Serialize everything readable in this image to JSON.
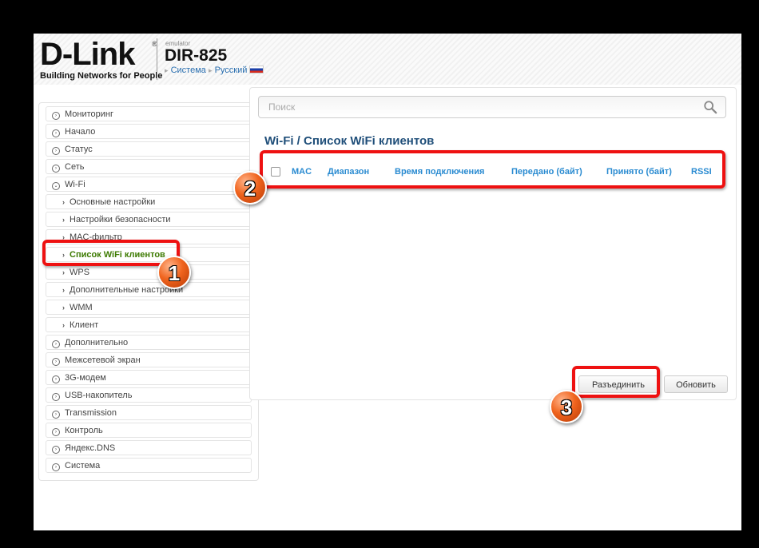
{
  "header": {
    "logo": "D-Link",
    "logo_mark": "®",
    "tagline": "Building Networks for People",
    "emulator": "emulator",
    "model": "DIR-825",
    "crumb_1": "Система",
    "crumb_2": "Русский",
    "crumb_arrow": "▸"
  },
  "sidebar": {
    "items": [
      {
        "label": "Мониторинг"
      },
      {
        "label": "Начало"
      },
      {
        "label": "Статус"
      },
      {
        "label": "Сеть"
      },
      {
        "label": "Wi-Fi"
      },
      {
        "label": "Основные настройки"
      },
      {
        "label": "Настройки безопасности"
      },
      {
        "label": "MAC-фильтр"
      },
      {
        "label": "Список WiFi клиентов"
      },
      {
        "label": "WPS"
      },
      {
        "label": "Дополнительные настройки"
      },
      {
        "label": "WMM"
      },
      {
        "label": "Клиент"
      },
      {
        "label": "Дополнительно"
      },
      {
        "label": "Межсетевой экран"
      },
      {
        "label": "3G-модем"
      },
      {
        "label": "USB-накопитель"
      },
      {
        "label": "Transmission"
      },
      {
        "label": "Контроль"
      },
      {
        "label": "Яндекс.DNS"
      },
      {
        "label": "Система"
      }
    ]
  },
  "main": {
    "search_placeholder": "Поиск",
    "title": "Wi-Fi /  Список WiFi клиентов",
    "columns": [
      "MAC",
      "Диапазон",
      "Время подключения",
      "Передано (байт)",
      "Принято (байт)",
      "RSSI"
    ],
    "disconnect_label": "Разъединить",
    "refresh_label": "Обновить"
  },
  "annotations": {
    "badge_1": "1",
    "badge_2": "2",
    "badge_3": "3",
    "color": "#e11111"
  }
}
